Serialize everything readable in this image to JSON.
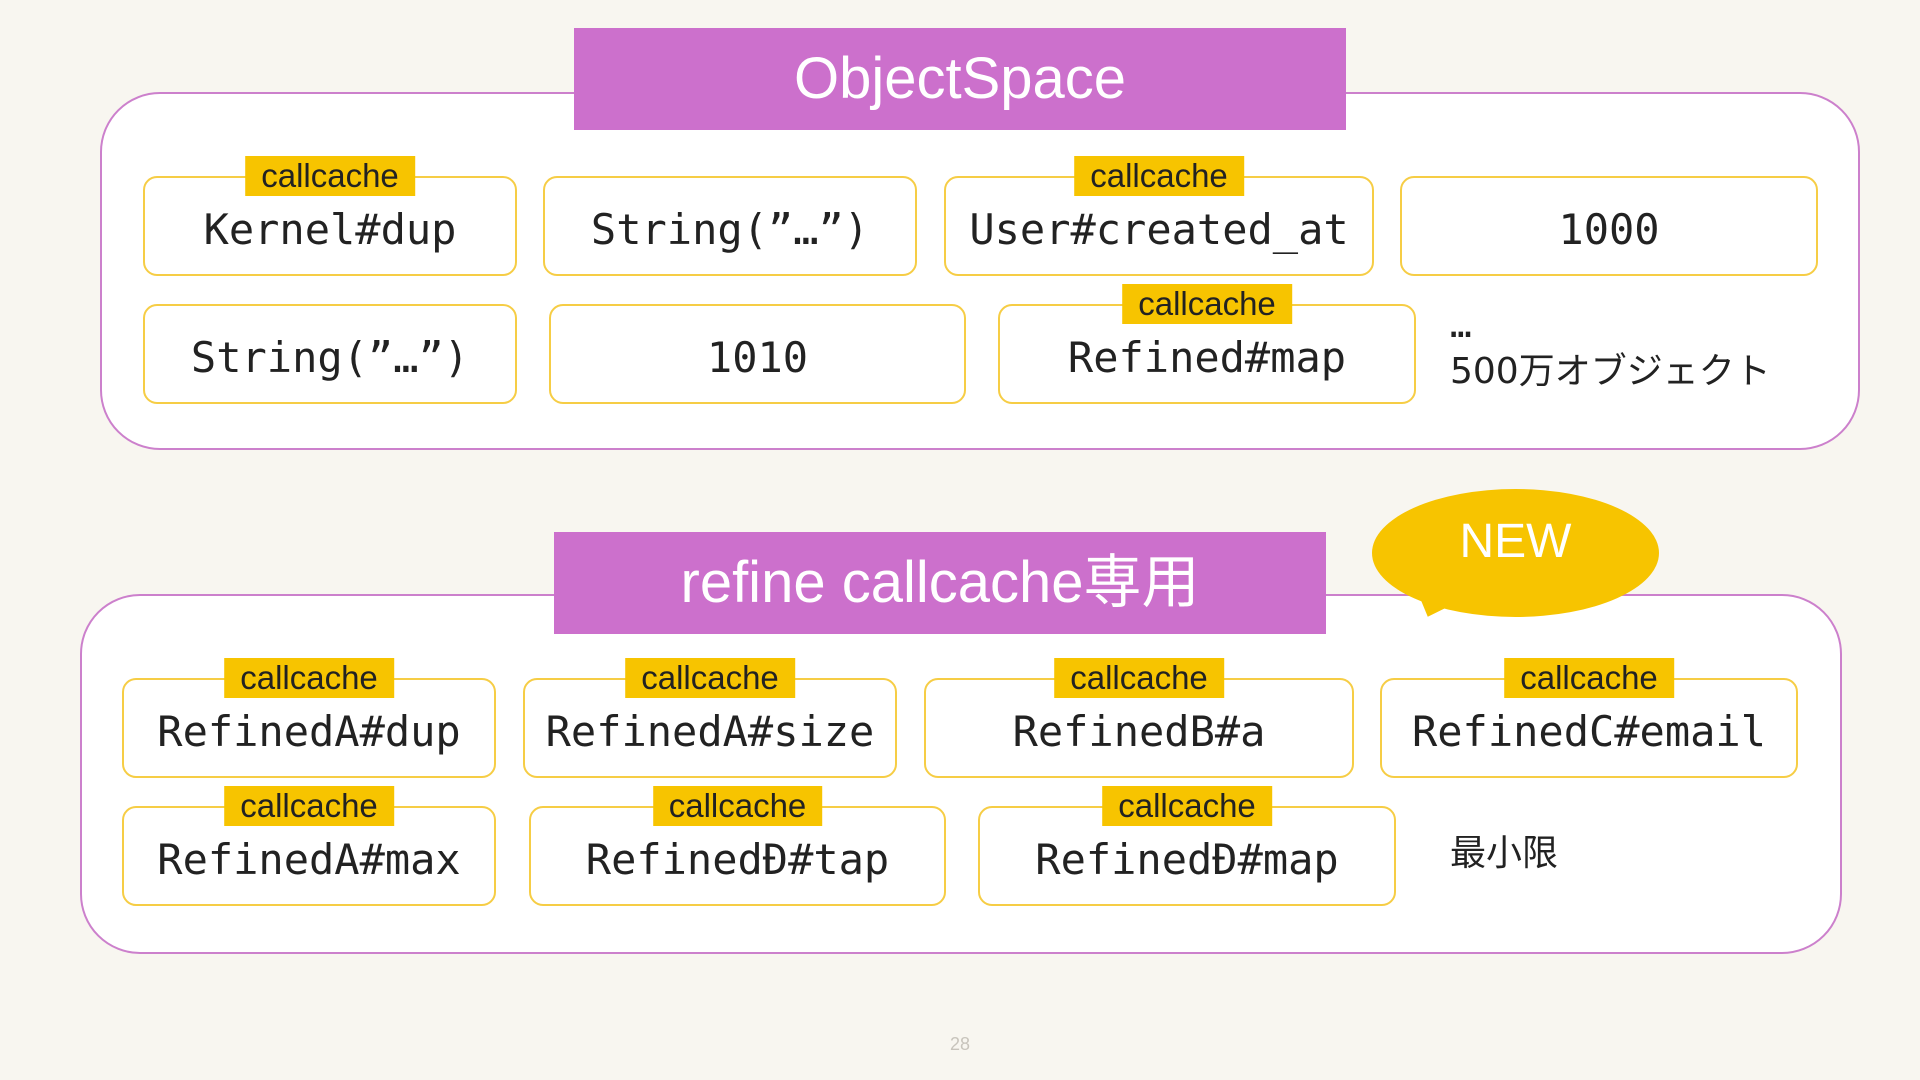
{
  "colors": {
    "background": "#f8f6f0",
    "banner": "#cc70cc",
    "panel_border": "#cc80cc",
    "box_border": "#f6cd45",
    "tag": "#f7c400"
  },
  "objectspace": {
    "title": "ObjectSpace",
    "boxes": [
      {
        "label": "Kernel#dup",
        "tag": "callcache"
      },
      {
        "label": "String(”…”)"
      },
      {
        "label": "User#created_at",
        "tag": "callcache"
      },
      {
        "label": "1000"
      },
      {
        "label": "String(”…”)"
      },
      {
        "label": "1010"
      },
      {
        "label": "Refined#map",
        "tag": "callcache"
      }
    ],
    "ellipsis": "…",
    "note": "500万オブジェクト"
  },
  "refine": {
    "title": "refine callcache専用",
    "badge": "NEW",
    "boxes": [
      {
        "label": "RefinedA#dup",
        "tag": "callcache"
      },
      {
        "label": "RefinedA#size",
        "tag": "callcache"
      },
      {
        "label": "RefinedB#a",
        "tag": "callcache"
      },
      {
        "label": "RefinedC#email",
        "tag": "callcache"
      },
      {
        "label": "RefinedA#max",
        "tag": "callcache"
      },
      {
        "label": "RefinedĐ#tap",
        "tag": "callcache"
      },
      {
        "label": "RefinedĐ#map",
        "tag": "callcache"
      }
    ],
    "note": "最小限"
  },
  "page_number": "28"
}
